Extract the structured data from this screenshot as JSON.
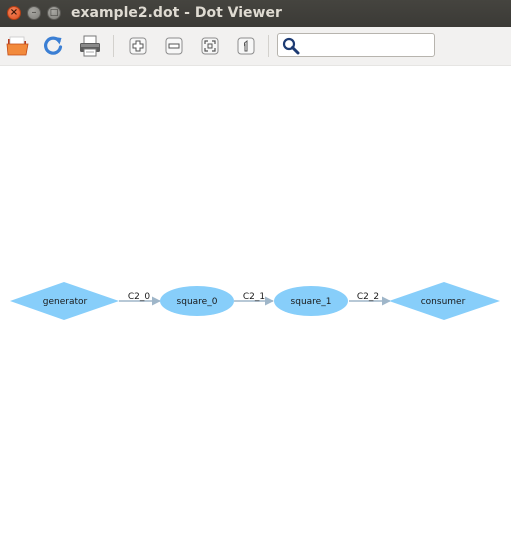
{
  "window": {
    "title": "example2.dot - Dot Viewer",
    "close_glyph": "×",
    "minimize_glyph": "–",
    "maximize_glyph": "□"
  },
  "toolbar": {
    "items": [
      {
        "icon": "open-folder-icon"
      },
      {
        "icon": "reload-icon"
      },
      {
        "icon": "print-icon"
      },
      {
        "icon": "zoom-in-icon"
      },
      {
        "icon": "zoom-out-icon"
      },
      {
        "icon": "zoom-fit-icon"
      },
      {
        "icon": "zoom-100-icon"
      }
    ],
    "search": {
      "icon": "search-icon",
      "value": "",
      "placeholder": ""
    }
  },
  "colors": {
    "node_fill": "#87cefa",
    "edge": "#9fb6c9",
    "titlebar": "#3f3e3a",
    "toolbar": "#f2f1f0"
  },
  "graph": {
    "nodes": [
      {
        "id": "generator",
        "label": "generator",
        "shape": "diamond"
      },
      {
        "id": "square_0",
        "label": "square_0",
        "shape": "ellipse"
      },
      {
        "id": "square_1",
        "label": "square_1",
        "shape": "ellipse"
      },
      {
        "id": "consumer",
        "label": "consumer",
        "shape": "diamond"
      }
    ],
    "edges": [
      {
        "from": "generator",
        "to": "square_0",
        "label": "C2_0"
      },
      {
        "from": "square_0",
        "to": "square_1",
        "label": "C2_1"
      },
      {
        "from": "square_1",
        "to": "consumer",
        "label": "C2_2"
      }
    ]
  }
}
